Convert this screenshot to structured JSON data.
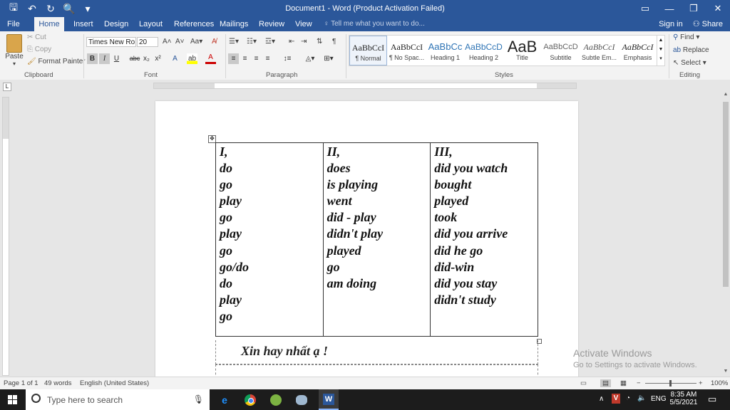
{
  "titlebar": {
    "title": "Document1 - Word (Product Activation Failed)",
    "qat": [
      {
        "name": "save-icon",
        "glyph": "🖫"
      },
      {
        "name": "undo-icon",
        "glyph": "↶"
      },
      {
        "name": "redo-icon",
        "glyph": "↻"
      },
      {
        "name": "print-preview-icon",
        "glyph": "🔍"
      },
      {
        "name": "customize-qat-icon",
        "glyph": "▾"
      }
    ],
    "controls": {
      "ribbon": "▭",
      "minimize": "—",
      "restore": "❐",
      "close": "✕"
    }
  },
  "tabs": [
    "File",
    "Home",
    "Insert",
    "Design",
    "Layout",
    "References",
    "Mailings",
    "Review",
    "View"
  ],
  "active_tab": "Home",
  "tell_me": "Tell me what you want to do...",
  "sign_in": "Sign in",
  "share": "Share",
  "ribbon": {
    "clipboard": {
      "label": "Clipboard",
      "paste": "Paste",
      "cut": "Cut",
      "copy": "Copy",
      "format_painter": "Format Painter"
    },
    "font": {
      "label": "Font",
      "family": "Times New Ro",
      "size": "20",
      "bold": "B",
      "italic": "I",
      "underline": "U",
      "strike": "abc",
      "sub": "x₂",
      "sup": "x²"
    },
    "paragraph": {
      "label": "Paragraph"
    },
    "styles": {
      "label": "Styles",
      "items": [
        {
          "sample": "AaBbCcI",
          "name": "¶ Normal"
        },
        {
          "sample": "AaBbCcI",
          "name": "¶ No Spac..."
        },
        {
          "sample": "AaBbCc",
          "name": "Heading 1"
        },
        {
          "sample": "AaBbCcD",
          "name": "Heading 2"
        },
        {
          "sample": "AaB",
          "name": "Title"
        },
        {
          "sample": "AaBbCcD",
          "name": "Subtitle"
        },
        {
          "sample": "AaBbCcI",
          "name": "Subtle Em..."
        },
        {
          "sample": "AaBbCcI",
          "name": "Emphasis"
        }
      ]
    },
    "editing": {
      "label": "Editing",
      "find": "Find",
      "replace": "Replace",
      "select": "Select"
    }
  },
  "document": {
    "columns": [
      [
        "I,",
        "do",
        "go",
        "play",
        "go",
        "play",
        "go",
        "go/do",
        "do",
        "play",
        "go"
      ],
      [
        "II,",
        "does",
        "is playing",
        "went",
        "did - play",
        "didn't play",
        "played",
        "go",
        "am doing"
      ],
      [
        "III,",
        "did you watch",
        "bought",
        "played",
        "took",
        "did you arrive",
        "did he go",
        "did-win",
        "did you stay",
        "didn't study"
      ]
    ],
    "closing": "Xin hay nhất ạ !"
  },
  "watermark": {
    "line1": "Activate Windows",
    "line2": "Go to Settings to activate Windows."
  },
  "status": {
    "page": "Page 1 of 1",
    "words": "49 words",
    "language": "English (United States)",
    "zoom": "100%"
  },
  "taskbar": {
    "search_placeholder": "Type here to search",
    "lang": "ENG",
    "time": "8:35 AM",
    "date": "5/5/2021"
  }
}
